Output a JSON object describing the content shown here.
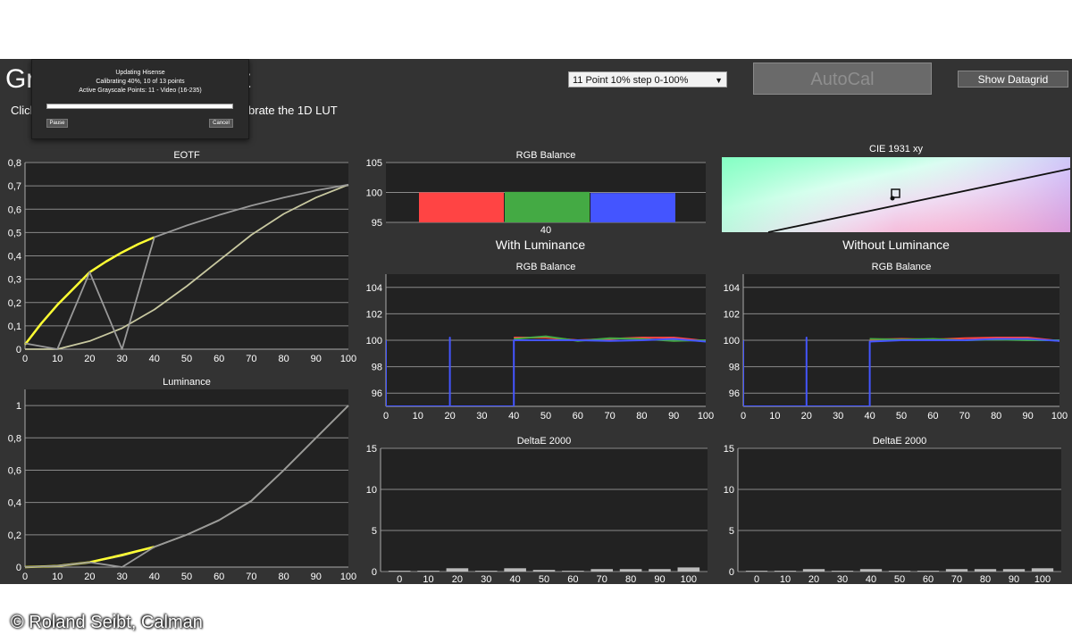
{
  "header": {
    "title": "Gr",
    "title_tail": "t",
    "instruction_start": "Click",
    "instruction_tail": "alibrate the 1D LUT",
    "dropdown_value": "11 Point 10% step 0-100%",
    "autocal_label": "AutoCal",
    "datagrid_label": "Show Datagrid"
  },
  "dialog": {
    "title": "Updating Hisense",
    "progress_text": "Calibrating 40%, 10 of 13 points",
    "points_text": "Active Grayscale Points: 11 - Video (16-235)",
    "progress": 0.4,
    "pause_label": "Pause",
    "cancel_label": "Cancel"
  },
  "labels": {
    "with_luminance": "With Luminance",
    "without_luminance": "Without Luminance"
  },
  "credit": "© Roland Seibt, Calman",
  "colors": {
    "app_bg": "#333333",
    "plot_bg": "#222222",
    "yellow": "#ffff33",
    "gray_curve": "#999999",
    "red": "#ff4444",
    "green": "#44aa44",
    "blue": "#4455ff"
  },
  "chart_data": [
    {
      "id": "eotf",
      "type": "line",
      "title": "EOTF",
      "xlim": [
        0,
        100
      ],
      "ylim": [
        0,
        0.8
      ],
      "xticks": [
        0,
        10,
        20,
        30,
        40,
        50,
        60,
        70,
        80,
        90,
        100
      ],
      "yticks": [
        0,
        0.1,
        0.2,
        0.3,
        0.4,
        0.5,
        0.6,
        0.7,
        0.8
      ],
      "ytick_labels": [
        "0",
        "0,1",
        "0,2",
        "0,3",
        "0,4",
        "0,5",
        "0,6",
        "0,7",
        "0,8"
      ],
      "series": [
        {
          "role": "target",
          "x": [
            0,
            10,
            20,
            30,
            40,
            50,
            60,
            70,
            80,
            90,
            100
          ],
          "y": [
            0,
            0.0,
            0.035,
            0.09,
            0.17,
            0.27,
            0.38,
            0.49,
            0.58,
            0.65,
            0.705
          ]
        },
        {
          "role": "measured",
          "x": [
            0,
            5,
            10,
            15,
            20,
            25,
            30,
            35,
            40
          ],
          "y": [
            0.02,
            0.11,
            0.19,
            0.26,
            0.33,
            0.375,
            0.415,
            0.45,
            0.48
          ]
        },
        {
          "role": "measured-gray",
          "x": [
            0,
            10,
            20,
            30,
            40,
            50,
            60,
            70,
            80,
            90,
            100
          ],
          "y": [
            0.025,
            0.0,
            0.33,
            0.0,
            0.48,
            0.53,
            0.575,
            0.615,
            0.65,
            0.68,
            0.705
          ]
        }
      ]
    },
    {
      "id": "luminance",
      "type": "line",
      "title": "Luminance",
      "xlim": [
        0,
        100
      ],
      "ylim": [
        0,
        1.1
      ],
      "xticks": [
        0,
        10,
        20,
        30,
        40,
        50,
        60,
        70,
        80,
        90,
        100
      ],
      "yticks": [
        0,
        0.2,
        0.4,
        0.6,
        0.8,
        1
      ],
      "ytick_labels": [
        "0",
        "0,2",
        "0,4",
        "0,6",
        "0,8",
        "1"
      ],
      "series": [
        {
          "role": "target",
          "x": [
            0,
            10,
            20,
            30,
            40,
            50,
            60,
            70,
            80,
            90,
            100
          ],
          "y": [
            0,
            0.007,
            0.03,
            0.07,
            0.125,
            0.2,
            0.29,
            0.41,
            0.6,
            0.8,
            1.0
          ]
        },
        {
          "role": "measured",
          "x": [
            0,
            10,
            20,
            30,
            40
          ],
          "y": [
            0,
            0.007,
            0.03,
            0.075,
            0.125
          ]
        },
        {
          "role": "measured-gray",
          "x": [
            0,
            10,
            20,
            30,
            40,
            50,
            60,
            70,
            80,
            90,
            100
          ],
          "y": [
            0,
            0.007,
            0.03,
            0.0,
            0.125,
            0.2,
            0.29,
            0.41,
            0.6,
            0.8,
            1.0
          ]
        }
      ]
    },
    {
      "id": "rgb-balance-top",
      "type": "bar",
      "title": "RGB Balance",
      "ylim": [
        95,
        105
      ],
      "yticks": [
        95,
        100,
        105
      ],
      "categories": [
        "40"
      ],
      "series": [
        {
          "name": "R",
          "values": [
            100.0
          ]
        },
        {
          "name": "G",
          "values": [
            100.1
          ]
        },
        {
          "name": "B",
          "values": [
            99.9
          ]
        }
      ]
    },
    {
      "id": "cie",
      "type": "scatter",
      "title": "CIE 1931 xy"
    },
    {
      "id": "rgb-with",
      "type": "line",
      "title": "RGB Balance",
      "xlim": [
        0,
        100
      ],
      "ylim": [
        95,
        105
      ],
      "xticks": [
        0,
        10,
        20,
        30,
        40,
        50,
        60,
        70,
        80,
        90,
        100
      ],
      "yticks": [
        96,
        98,
        100,
        102,
        104
      ],
      "series": [
        {
          "name": "R",
          "x": [
            40,
            50,
            60,
            70,
            80,
            90,
            100
          ],
          "y": [
            100.2,
            100.2,
            100.0,
            100.1,
            100.2,
            100.2,
            99.95
          ]
        },
        {
          "name": "G",
          "x": [
            40,
            50,
            60,
            70,
            80,
            90,
            100
          ],
          "y": [
            100.1,
            100.3,
            99.95,
            100.15,
            100.1,
            99.95,
            100.0
          ]
        },
        {
          "name": "B",
          "x": [
            0,
            0,
            20,
            20,
            20,
            40,
            40,
            50,
            60,
            70,
            80,
            90,
            100
          ],
          "y": [
            100,
            95,
            95,
            100.2,
            95,
            95,
            100.0,
            100.0,
            100.0,
            99.95,
            100.0,
            100.1,
            99.9
          ]
        }
      ]
    },
    {
      "id": "rgb-without",
      "type": "line",
      "title": "RGB Balance",
      "xlim": [
        0,
        100
      ],
      "ylim": [
        95,
        105
      ],
      "xticks": [
        0,
        10,
        20,
        30,
        40,
        50,
        60,
        70,
        80,
        90,
        100
      ],
      "yticks": [
        96,
        98,
        100,
        102,
        104
      ],
      "series": [
        {
          "name": "R",
          "x": [
            40,
            50,
            60,
            70,
            80,
            90,
            100
          ],
          "y": [
            100.05,
            100.1,
            100.05,
            100.15,
            100.2,
            100.2,
            99.95
          ]
        },
        {
          "name": "G",
          "x": [
            40,
            50,
            60,
            70,
            80,
            90,
            100
          ],
          "y": [
            100.1,
            100.05,
            100.1,
            100.0,
            100.05,
            100.0,
            100.0
          ]
        },
        {
          "name": "B",
          "x": [
            0,
            0,
            20,
            20,
            20,
            40,
            40,
            50,
            60,
            70,
            80,
            90,
            100
          ],
          "y": [
            100,
            95,
            95,
            100.2,
            95,
            95,
            99.9,
            100.0,
            100.0,
            100.0,
            100.1,
            100.1,
            99.95
          ]
        }
      ]
    },
    {
      "id": "deltae-with",
      "type": "bar",
      "title": "DeltaE 2000",
      "ylim": [
        0,
        15
      ],
      "yticks": [
        0,
        5,
        10,
        15
      ],
      "categories": [
        "0",
        "10",
        "20",
        "30",
        "40",
        "50",
        "60",
        "70",
        "80",
        "90",
        "100"
      ],
      "values": [
        0.1,
        0.1,
        0.4,
        0.1,
        0.4,
        0.2,
        0.1,
        0.3,
        0.3,
        0.3,
        0.5
      ]
    },
    {
      "id": "deltae-without",
      "type": "bar",
      "title": "DeltaE 2000",
      "ylim": [
        0,
        15
      ],
      "yticks": [
        0,
        5,
        10,
        15
      ],
      "categories": [
        "0",
        "10",
        "20",
        "30",
        "40",
        "50",
        "60",
        "70",
        "80",
        "90",
        "100"
      ],
      "values": [
        0.1,
        0.1,
        0.3,
        0.1,
        0.3,
        0.1,
        0.1,
        0.3,
        0.3,
        0.3,
        0.4
      ]
    }
  ]
}
